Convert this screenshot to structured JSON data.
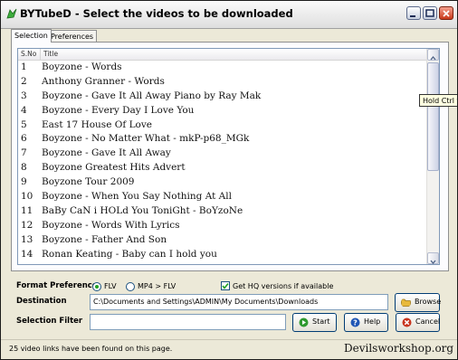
{
  "window": {
    "title": "BYTubeD - Select the videos to be downloaded"
  },
  "tabs": [
    {
      "label": "Selection",
      "active": true
    },
    {
      "label": "Preferences",
      "active": false
    }
  ],
  "list": {
    "headers": {
      "number": "S.No",
      "title": "Title"
    },
    "rows": [
      {
        "n": "1",
        "title": "Boyzone - Words"
      },
      {
        "n": "2",
        "title": "Anthony Granner - Words"
      },
      {
        "n": "3",
        "title": "Boyzone - Gave It All Away Piano by Ray Mak"
      },
      {
        "n": "4",
        "title": "Boyzone - Every Day I Love You"
      },
      {
        "n": "5",
        "title": "East 17 House Of Love"
      },
      {
        "n": "6",
        "title": "Boyzone - No Matter What - mkP-p68_MGk"
      },
      {
        "n": "7",
        "title": "Boyzone - Gave It All Away"
      },
      {
        "n": "8",
        "title": "Boyzone Greatest Hits Advert"
      },
      {
        "n": "9",
        "title": "Boyzone Tour 2009"
      },
      {
        "n": "10",
        "title": "Boyzone - When You Say Nothing At All"
      },
      {
        "n": "11",
        "title": "BaBy CaN i HOLd You ToniGht - BoYzoNe"
      },
      {
        "n": "12",
        "title": "Boyzone - Words With Lyrics"
      },
      {
        "n": "13",
        "title": "Boyzone - Father And Son"
      },
      {
        "n": "14",
        "title": "Ronan Keating - Baby can I hold you"
      }
    ]
  },
  "tooltip": {
    "text": "Hold Ctrl to"
  },
  "format": {
    "label": "Format Preference",
    "options": [
      {
        "label": "FLV",
        "selected": true
      },
      {
        "label": "MP4 > FLV",
        "selected": false
      }
    ],
    "hq_label": "Get HQ versions if available",
    "hq_checked": true
  },
  "destination": {
    "label": "Destination",
    "value": "C:\\Documents and Settings\\ADMIN\\My Documents\\Downloads",
    "browse_label": "Browse"
  },
  "filter": {
    "label": "Selection Filter",
    "value": "",
    "start_label": "Start",
    "help_label": "Help",
    "cancel_label": "Cancel"
  },
  "status": {
    "text": "25 video links have been found on this page."
  },
  "watermark": {
    "text": "Devilsworkshop.org"
  },
  "colors": {
    "start_green": "#2f9a2f",
    "help_blue": "#1f55b5",
    "cancel_red": "#c8341e",
    "check_green": "#21a121"
  }
}
